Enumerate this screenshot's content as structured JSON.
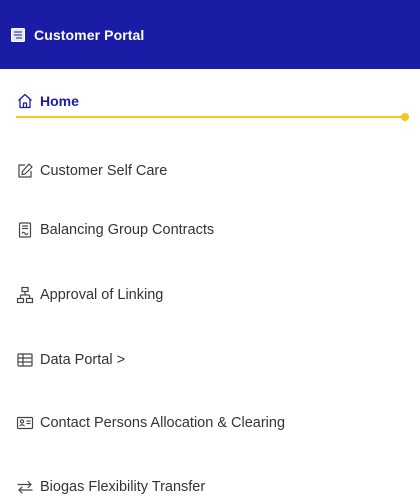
{
  "header": {
    "title": "Customer Portal",
    "icon": "document-list-icon",
    "background": "#1a1ca5"
  },
  "nav": {
    "active_color": "#1a1ca5",
    "indicator_color": "#f5c518",
    "items": [
      {
        "label": "Home",
        "icon": "home-icon",
        "active": true
      },
      {
        "label": "Customer Self Care",
        "icon": "edit-icon",
        "active": false
      },
      {
        "label": "Balancing Group Contracts",
        "icon": "contract-document-icon",
        "active": false
      },
      {
        "label": "Approval of Linking",
        "icon": "network-hierarchy-icon",
        "active": false
      },
      {
        "label": "Data Portal >",
        "icon": "table-grid-icon",
        "active": false
      },
      {
        "label": "Contact Persons Allocation & Clearing",
        "icon": "contact-card-icon",
        "active": false
      },
      {
        "label": "Biogas Flexibility Transfer",
        "icon": "transfer-arrows-icon",
        "active": false
      }
    ]
  }
}
